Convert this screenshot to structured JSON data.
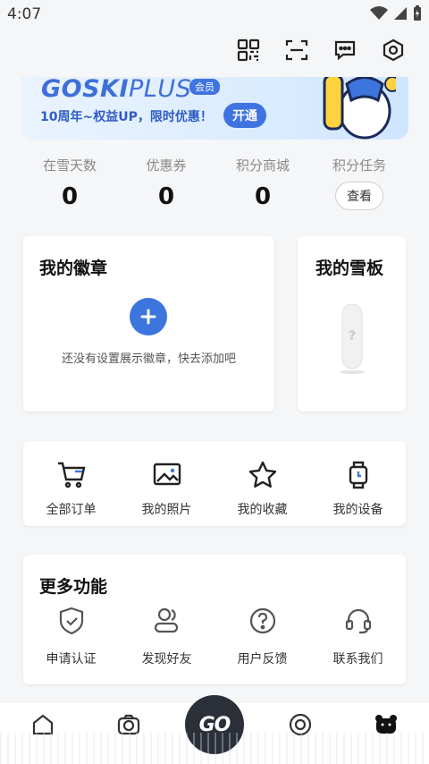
{
  "status": {
    "time": "4:07"
  },
  "top_actions": [
    {
      "name": "qr-code-icon"
    },
    {
      "name": "scan-icon"
    },
    {
      "name": "message-icon"
    },
    {
      "name": "settings-icon"
    }
  ],
  "banner": {
    "brand_bold": "GOSKI",
    "brand_light": "PLUS",
    "tag": "会员",
    "subtitle": "10周年~权益UP，限时优惠！",
    "button": "开通"
  },
  "stats": [
    {
      "label": "在雪天数",
      "value": "0"
    },
    {
      "label": "优惠券",
      "value": "0"
    },
    {
      "label": "积分商城",
      "value": "0"
    },
    {
      "label": "积分任务",
      "button": "查看"
    }
  ],
  "badges": {
    "title": "我的徽章",
    "empty_text": "还没有设置展示徽章，快去添加吧"
  },
  "snowboard": {
    "title": "我的雪板",
    "placeholder": "?"
  },
  "quick_links": [
    {
      "label": "全部订单",
      "icon": "cart-icon"
    },
    {
      "label": "我的照片",
      "icon": "photo-icon"
    },
    {
      "label": "我的收藏",
      "icon": "star-icon"
    },
    {
      "label": "我的设备",
      "icon": "watch-icon"
    }
  ],
  "more": {
    "title": "更多功能",
    "items": [
      {
        "label": "申请认证",
        "icon": "shield-check-icon"
      },
      {
        "label": "发现好友",
        "icon": "friends-icon"
      },
      {
        "label": "用户反馈",
        "icon": "help-icon"
      },
      {
        "label": "联系我们",
        "icon": "headset-icon"
      }
    ]
  },
  "tabbar": {
    "go_label": "GO"
  },
  "colors": {
    "accent": "#3d75de",
    "banner_text": "#2f5cc4"
  }
}
